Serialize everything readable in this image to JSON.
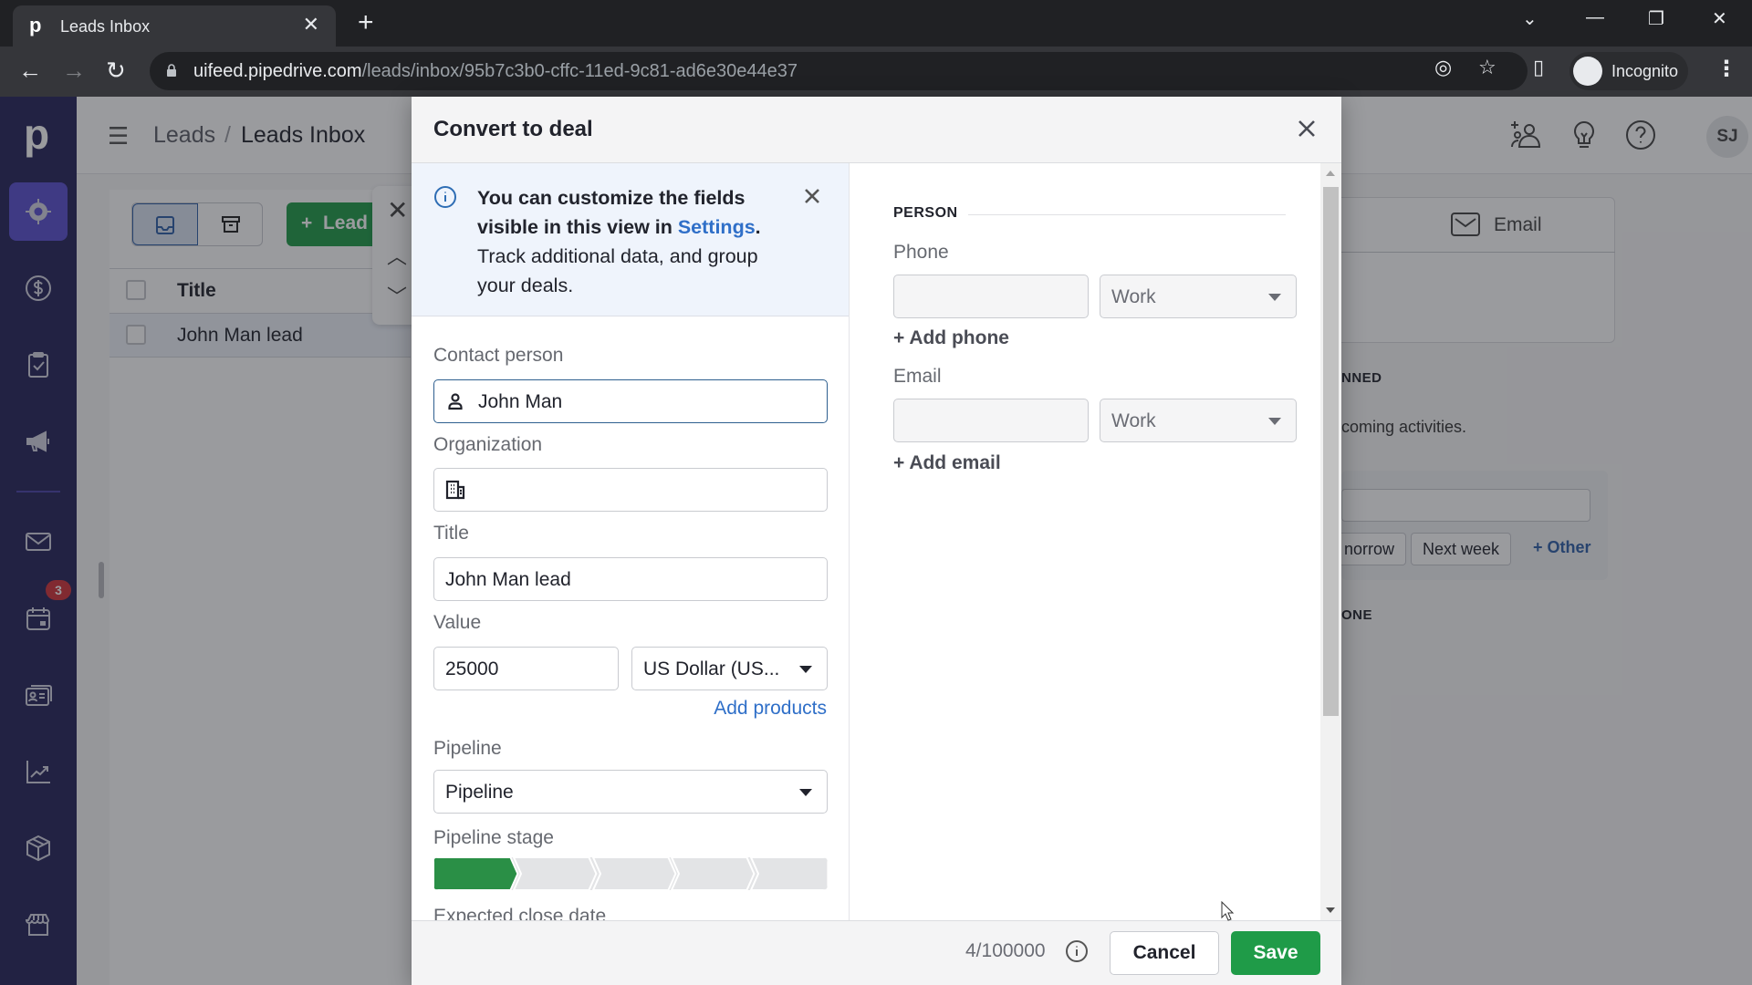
{
  "browser": {
    "tab_title": "Leads Inbox",
    "tab_favicon": "p",
    "url_host": "uifeed.pipedrive.com",
    "url_path": "/leads/inbox/95b7c3b0-cffc-11ed-9c81-ad6e30e44e37",
    "profile_label": "Incognito"
  },
  "sidebar": {
    "logo": "p",
    "items": [
      {
        "name": "leads",
        "icon": "target-icon",
        "active": true
      },
      {
        "name": "deals",
        "icon": "dollar-icon",
        "active": false
      },
      {
        "name": "activities",
        "icon": "clipboard-check-icon",
        "active": false
      },
      {
        "name": "campaigns",
        "icon": "megaphone-icon",
        "active": false
      },
      {
        "name": "mail",
        "icon": "mail-icon",
        "active": false
      },
      {
        "name": "calendar",
        "icon": "calendar-icon",
        "active": false,
        "badge": "3"
      },
      {
        "name": "contacts",
        "icon": "contact-card-icon",
        "active": false
      },
      {
        "name": "insights",
        "icon": "chart-line-icon",
        "active": false
      },
      {
        "name": "products",
        "icon": "box-icon",
        "active": false
      },
      {
        "name": "marketplace",
        "icon": "store-icon",
        "active": false
      }
    ]
  },
  "header": {
    "breadcrumb_parent": "Leads",
    "breadcrumb_separator": "/",
    "breadcrumb_current": "Leads Inbox",
    "avatar_initials": "SJ"
  },
  "leads_list": {
    "add_button_label": "Lead",
    "column_title": "Title",
    "rows": [
      {
        "title": "John Man lead"
      }
    ]
  },
  "detail_panel": {
    "email_tab_label": "Email",
    "planned_label": "NNED",
    "no_activities_text": "coming activities.",
    "quick_buttons": [
      "norrow",
      "Next week"
    ],
    "other_link": "+ Other",
    "done_label": "ONE"
  },
  "dialog": {
    "title": "Convert to deal",
    "info_banner": {
      "bold_text": "You can customize the fields visible in this view in ",
      "link_text": "Settings",
      "after_link": ".",
      "rest_text": " Track additional data, and group your deals."
    },
    "left": {
      "contact_person_label": "Contact person",
      "contact_person_value": "John Man",
      "organization_label": "Organization",
      "organization_value": "",
      "title_label": "Title",
      "title_value": "John Man lead",
      "value_label": "Value",
      "value_amount": "25000",
      "currency_selected": "US Dollar (US...",
      "add_products_link": "Add products",
      "pipeline_label": "Pipeline",
      "pipeline_selected": "Pipeline",
      "pipeline_stage_label": "Pipeline stage",
      "pipeline_stage_count": 5,
      "pipeline_stage_selected": 1,
      "expected_close_date_label": "Expected close date"
    },
    "right": {
      "section_header": "PERSON",
      "phone_label": "Phone",
      "phone_value": "",
      "phone_type": "Work",
      "add_phone_link": "+ Add phone",
      "email_label": "Email",
      "email_value": "",
      "email_type": "Work",
      "add_email_link": "+ Add email"
    },
    "footer": {
      "char_counter": "4/100000",
      "cancel_label": "Cancel",
      "save_label": "Save"
    }
  },
  "colors": {
    "sidebar_bg": "#26235a",
    "sidebar_active": "#5a4fd0",
    "primary_green": "#1f9b48",
    "link_blue": "#2f6fc8",
    "badge_red": "#d1323a"
  }
}
